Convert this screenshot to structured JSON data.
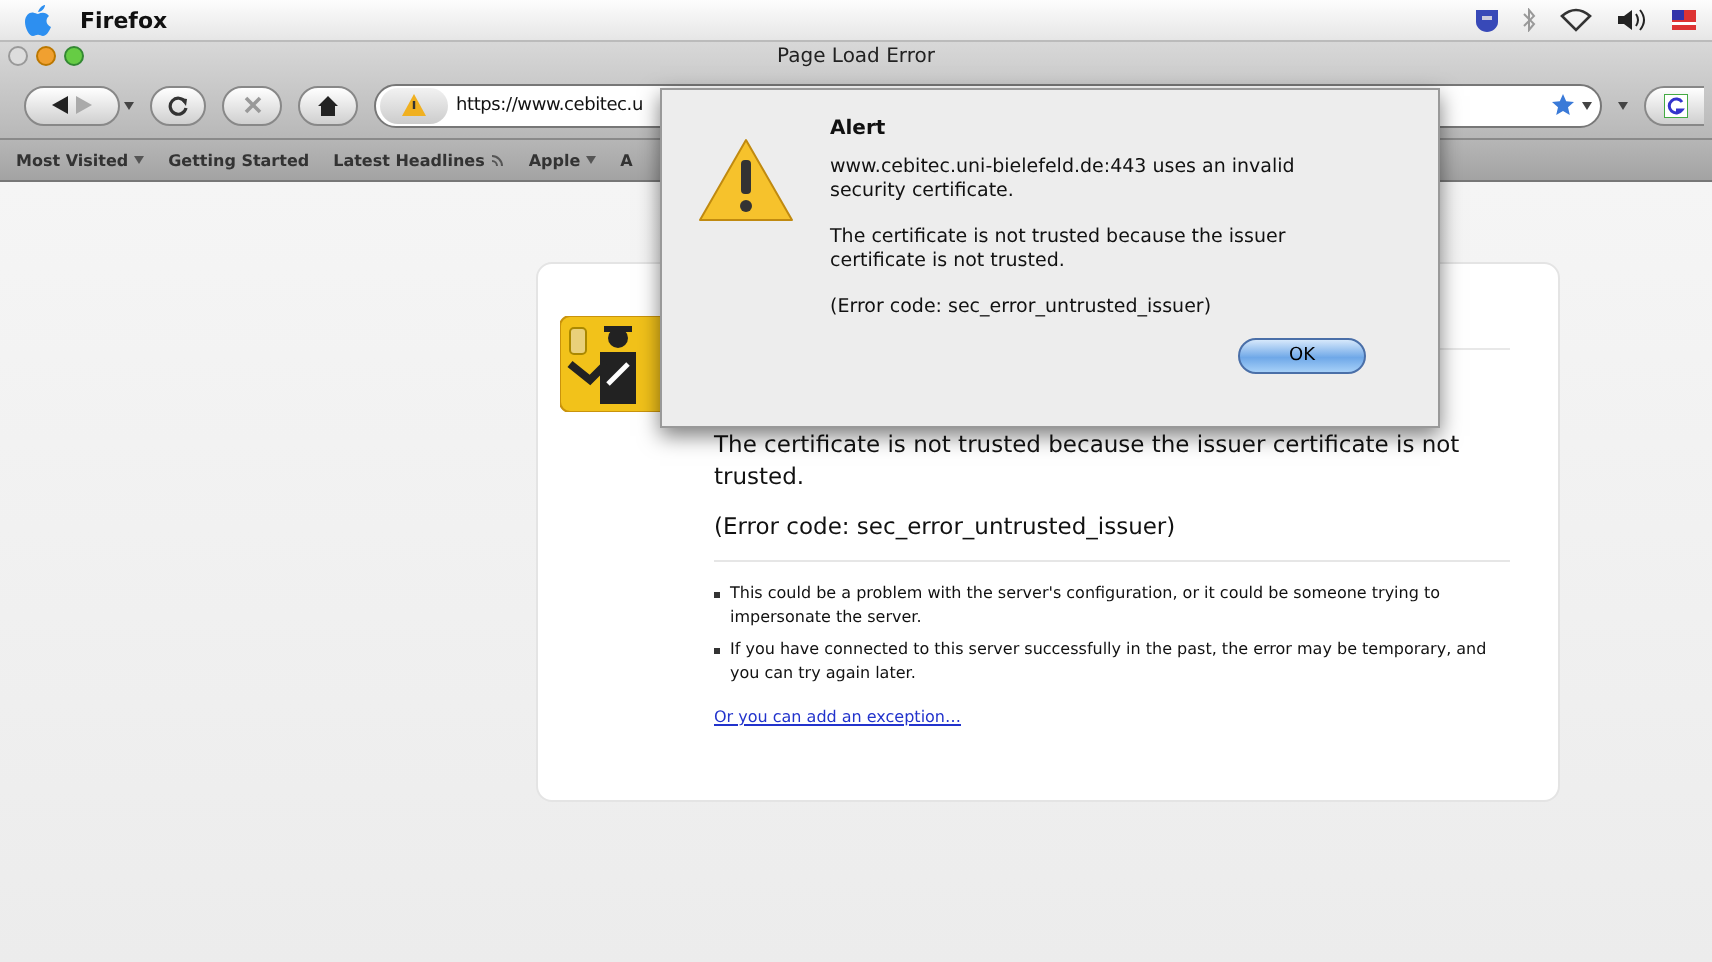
{
  "menubar": {
    "app": "Firefox"
  },
  "window": {
    "title": "Page Load Error"
  },
  "toolbar": {
    "url": "https://www.cebitec.u"
  },
  "bookmarks": [
    {
      "label": "Most Visited",
      "kind": "menu"
    },
    {
      "label": "Getting Started",
      "kind": "plain"
    },
    {
      "label": "Latest Headlines",
      "kind": "feed"
    },
    {
      "label": "Apple",
      "kind": "menu"
    },
    {
      "label": "A",
      "kind": "plain"
    }
  ],
  "page": {
    "description": "The certificate is not trusted because the issuer certificate is not trusted.",
    "error_code": "(Error code: sec_error_untrusted_issuer)",
    "bullets": [
      "This could be a problem with the server's configuration, or it could be someone trying to impersonate the server.",
      "If you have connected to this server successfully in the past, the error may be temporary, and you can try again later."
    ],
    "link": "Or you can add an exception…"
  },
  "alert": {
    "title": "Alert",
    "messages": [
      "www.cebitec.uni-bielefeld.de:443 uses an invalid security certificate.",
      "The certificate is not trusted because the issuer certificate is not trusted.",
      "(Error code: sec_error_untrusted_issuer)"
    ],
    "button": "OK"
  }
}
